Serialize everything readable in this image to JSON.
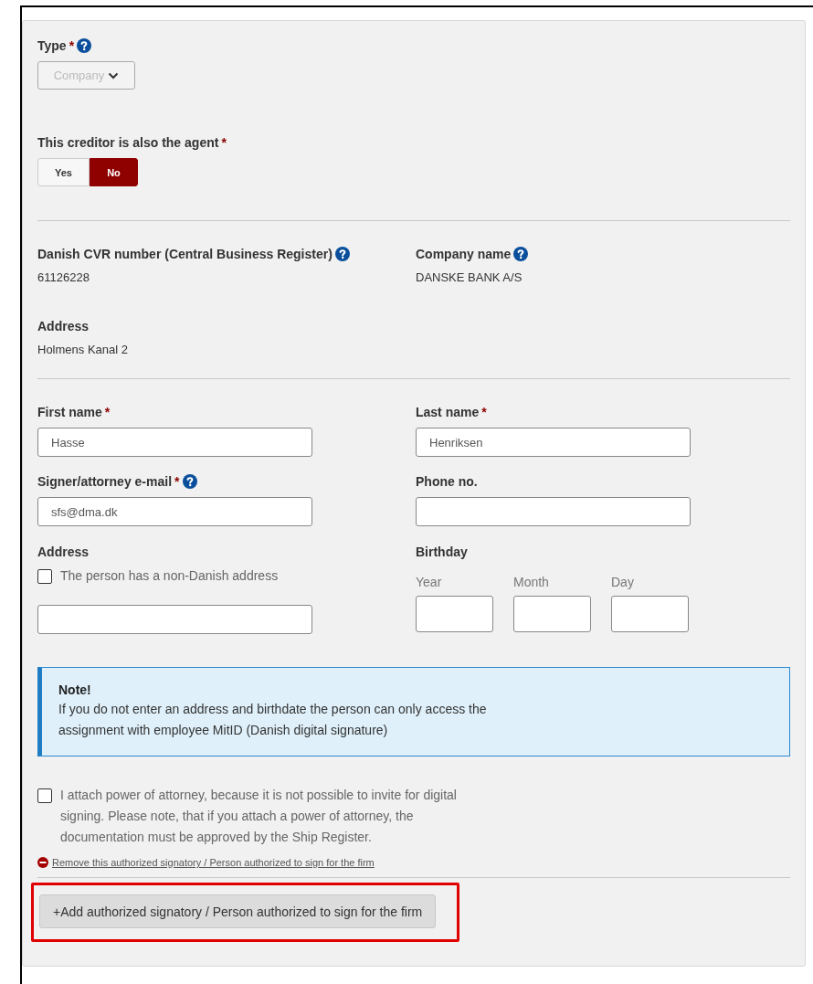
{
  "type_field": {
    "label": "Type",
    "required_mark": "*",
    "help": true,
    "value": "Company",
    "disabled": true
  },
  "agent_toggle": {
    "label": "This creditor is also the agent",
    "required_mark": "*",
    "options": [
      {
        "label": "Yes",
        "selected": false
      },
      {
        "label": "No",
        "selected": true
      }
    ]
  },
  "company_info": [
    {
      "label": "Danish CVR number (Central Business Register)",
      "help": true,
      "value": "61126228"
    },
    {
      "label": "Company name",
      "help": true,
      "value": "DANSKE BANK A/S"
    },
    {
      "label": "Address",
      "value": "Holmens Kanal 2"
    }
  ],
  "first_name": {
    "label": "First name",
    "required_mark": "*",
    "value": "Hasse"
  },
  "last_name": {
    "label": "Last name",
    "required_mark": "*",
    "value": "Henriksen"
  },
  "email": {
    "label": "Signer/attorney e-mail",
    "required_mark": "*",
    "help": true,
    "value": "sfs@dma.dk"
  },
  "phone": {
    "label": "Phone no."
  },
  "address": {
    "label": "Address",
    "checkbox": {
      "label": "The person has a non-Danish address",
      "checked": false
    }
  },
  "birthday": {
    "label": "Birthday",
    "parts": [
      {
        "label": "Year"
      },
      {
        "label": "Month"
      },
      {
        "label": "Day"
      }
    ]
  },
  "note": {
    "title": "Note!",
    "text": "If you do not enter an address and birthdate the person can only access the assignment with employee MitID (Danish digital signature)"
  },
  "power_of_attorney": {
    "label": "I attach power of attorney, because it is not possible to invite for digital signing. Please note, that if you attach a power of attorney, the documentation must be approved by the Ship Register.",
    "checked": false
  },
  "remove_link": "Remove this authorized signatory / Person authorized to sign for the firm",
  "add_button": {
    "label": "+Add authorized signatory / Person authorized to sign for the firm",
    "highlighted": true
  }
}
